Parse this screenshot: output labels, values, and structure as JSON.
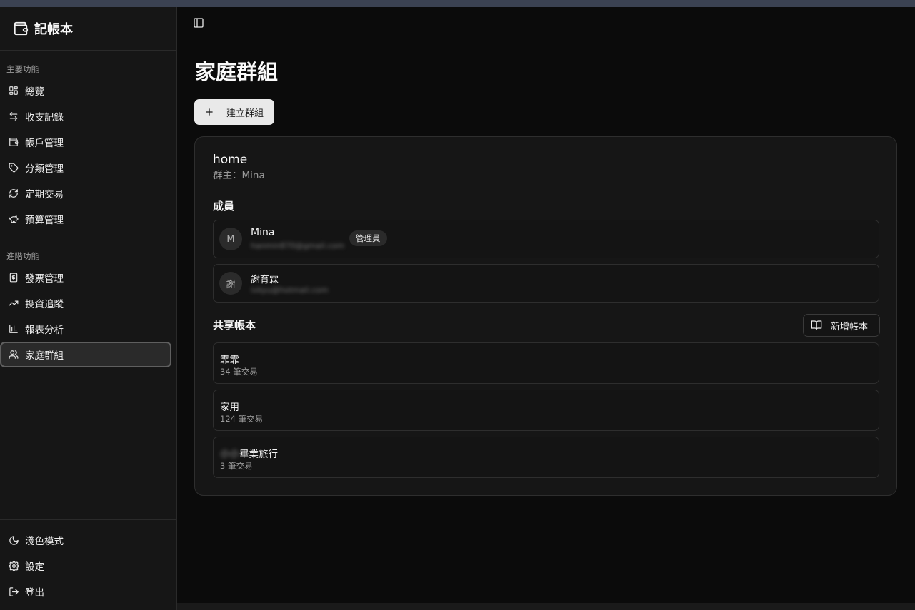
{
  "app": {
    "title": "記帳本"
  },
  "sidebar": {
    "main_section_label": "主要功能",
    "main_items": [
      {
        "label": "總覽",
        "icon": "dashboard-icon"
      },
      {
        "label": "收支記錄",
        "icon": "arrows-left-right-icon"
      },
      {
        "label": "帳戶管理",
        "icon": "wallet-icon"
      },
      {
        "label": "分類管理",
        "icon": "tag-icon"
      },
      {
        "label": "定期交易",
        "icon": "refresh-icon"
      },
      {
        "label": "預算管理",
        "icon": "piggy-bank-icon"
      }
    ],
    "advanced_section_label": "進階功能",
    "advanced_items": [
      {
        "label": "發票管理",
        "icon": "receipt-icon"
      },
      {
        "label": "投資追蹤",
        "icon": "trending-up-icon"
      },
      {
        "label": "報表分析",
        "icon": "bar-chart-icon"
      },
      {
        "label": "家庭群組",
        "icon": "users-icon",
        "active": true
      }
    ],
    "bottom_items": [
      {
        "label": "淺色模式",
        "icon": "moon-icon"
      },
      {
        "label": "設定",
        "icon": "gear-icon"
      },
      {
        "label": "登出",
        "icon": "logout-icon"
      }
    ]
  },
  "page": {
    "title": "家庭群組",
    "create_button": "建立群組"
  },
  "group": {
    "name": "home",
    "owner_line": "群主：Mina",
    "members_title": "成員",
    "members": [
      {
        "initial": "M",
        "name": "Mina",
        "email": "hanmin870@gmail.com",
        "role": "管理員"
      },
      {
        "initial": "謝",
        "name": "謝育霖",
        "email": "ivkyu@hotmail.com",
        "role": ""
      }
    ],
    "books_title": "共享帳本",
    "add_book_button": "新增帳本",
    "books": [
      {
        "prefix": "",
        "name": "霏霏",
        "count": "34 筆交易"
      },
      {
        "prefix": "",
        "name": "家用",
        "count": "124 筆交易"
      },
      {
        "prefix": "小小",
        "name": "畢業旅行",
        "count": "3 筆交易"
      }
    ]
  }
}
